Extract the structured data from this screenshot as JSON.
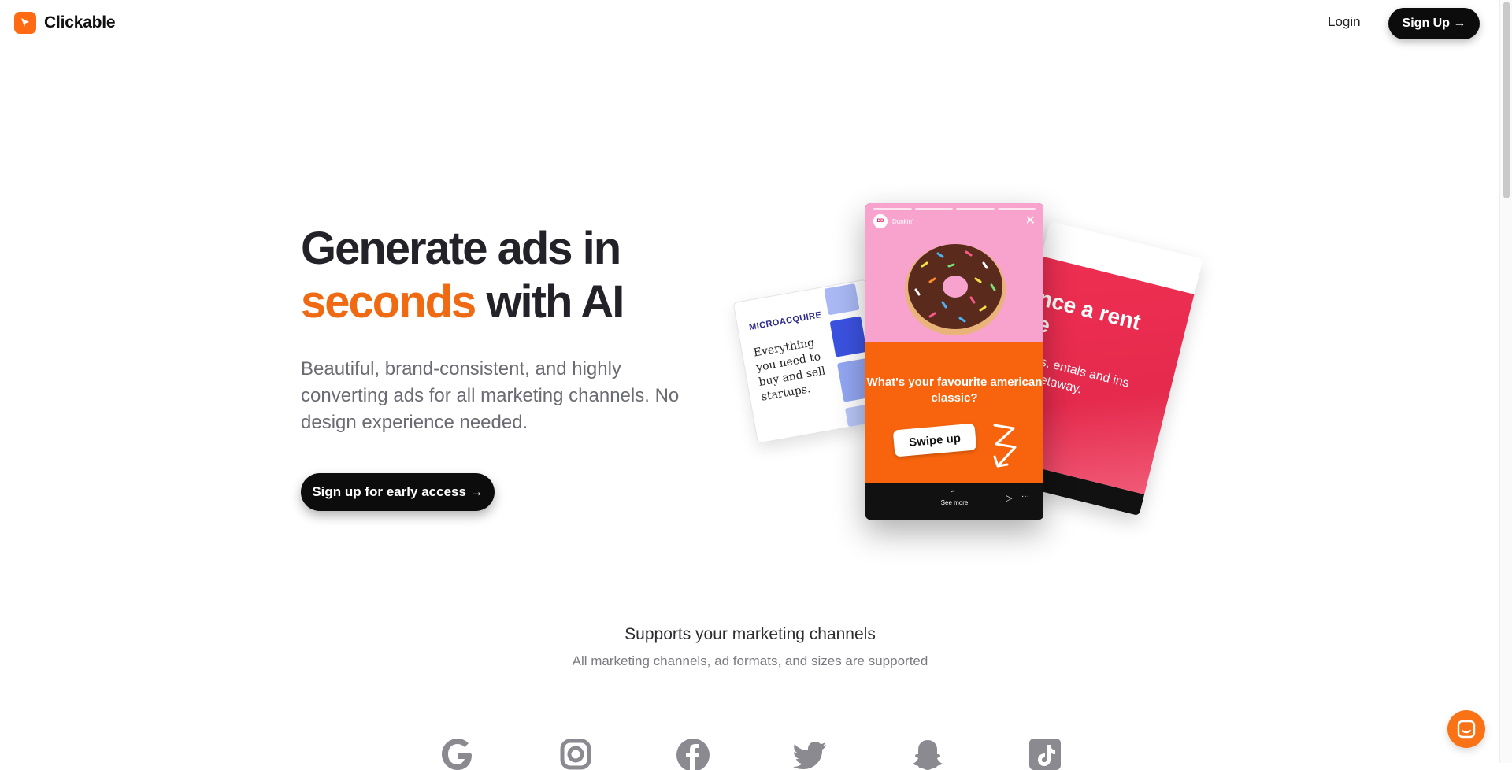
{
  "header": {
    "brand": "Clickable",
    "login_label": "Login",
    "signup_label": "Sign Up →"
  },
  "hero": {
    "headline_line1": "Generate ads in",
    "headline_accent": "seconds",
    "headline_rest": " with AI",
    "subtext": "Beautiful, brand-consistent, and highly converting ads for all marketing channels. No design experience needed.",
    "cta_label": "Sign up for early access →"
  },
  "ad_left": {
    "brand": "MICROACQUIRE",
    "copy": "Everything you need to buy and sell startups."
  },
  "ad_main": {
    "account": "Dunkin'",
    "question": "What's your favourite american classic?",
    "button": "Swipe up",
    "see_more": "See more"
  },
  "ad_right": {
    "title": "erience a rent place",
    "desc": "que homes, entals and ins perfect for etaway."
  },
  "supports": {
    "title": "Supports your marketing channels",
    "subtitle": "All marketing channels, ad formats, and sizes are supported",
    "channels": [
      "google-icon",
      "instagram-icon",
      "facebook-icon",
      "twitter-icon",
      "snapchat-icon",
      "tiktok-icon"
    ]
  },
  "colors": {
    "accent": "#ef6a12",
    "brand_orange": "#ff6a13",
    "dark": "#0c0c0c"
  }
}
